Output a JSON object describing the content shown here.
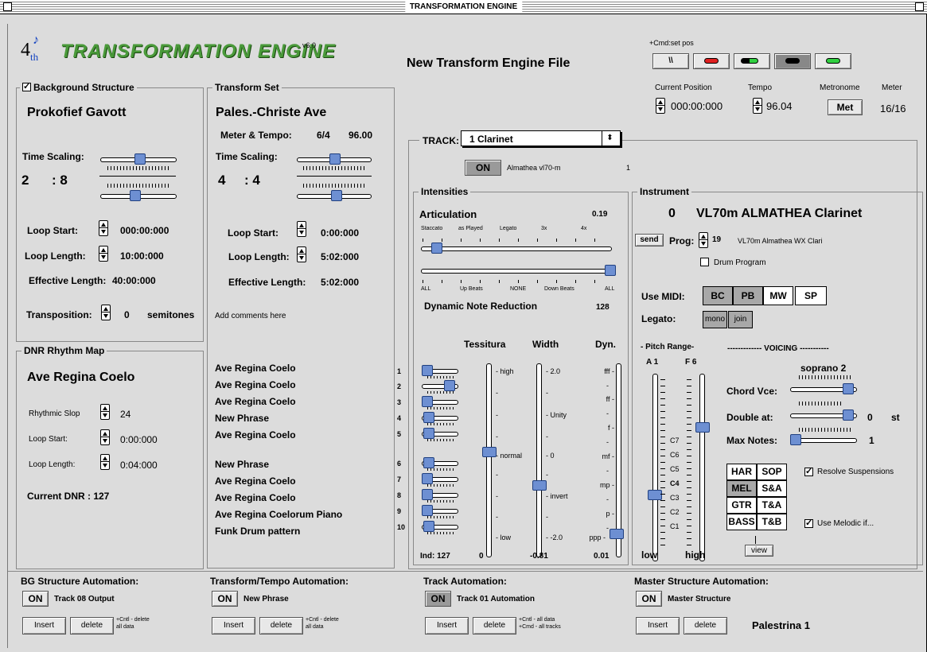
{
  "window": {
    "title": "TRANSFORMATION ENGINE"
  },
  "header": {
    "logo_num": "4",
    "logo_sup": "th",
    "app_title": "TRANSFORMATION ENGINE",
    "version": "v6.0",
    "file_name": "New Transform Engine File",
    "cmd_hint": "+Cmd:set pos"
  },
  "transport": {
    "backslash_label": "\\\\",
    "colors": {
      "red": "#e02020",
      "green": "#30d040",
      "black": "#000000"
    }
  },
  "status": {
    "position_label": "Current Position",
    "position": "000:00:000",
    "tempo_label": "Tempo",
    "tempo": "96.04",
    "metronome_label": "Metronome",
    "metronome_btn": "Met",
    "meter_label": "Meter",
    "meter": "16/16"
  },
  "bg": {
    "group_label": "Background Structure",
    "name": "Prokofief Gavott",
    "time_scaling_label": "Time Scaling:",
    "ts_num": "2",
    "ts_den": ": 8",
    "loop_start_label": "Loop Start:",
    "loop_start": "000:00:000",
    "loop_length_label": "Loop Length:",
    "loop_length": "10:00:000",
    "effective_label": "Effective Length:",
    "effective": "40:00:000",
    "transposition_label": "Transposition:",
    "transposition": "0",
    "semitones": "semitones"
  },
  "ts": {
    "group_label": "Transform Set",
    "name": "Pales.-Christe Ave",
    "meter_tempo_label": "Meter & Tempo:",
    "meter": "6/4",
    "tempo": "96.00",
    "time_scaling_label": "Time Scaling:",
    "ts_num": "4",
    "ts_den": ": 4",
    "loop_start_label": "Loop Start:",
    "loop_start": "0:00:000",
    "loop_length_label": "Loop Length:",
    "loop_length": "5:02:000",
    "effective_label": "Effective Length:",
    "effective": "5:02:000",
    "comments": "Add comments here"
  },
  "dnr": {
    "group_label": "DNR Rhythm Map",
    "name": "Ave Regina Coelo",
    "slop_label": "Rhythmic Slop",
    "slop": "24",
    "loop_start_label": "Loop Start:",
    "loop_start": "0:00:000",
    "loop_length_label": "Loop Length:",
    "loop_length": "0:04:000",
    "current_label": "Current DNR : 127"
  },
  "phrases": [
    "Ave Regina Coelo",
    "Ave Regina Coelo",
    "Ave Regina Coelo",
    "New Phrase",
    "Ave Regina Coelo",
    "New Phrase",
    "Ave Regina Coelo",
    "Ave Regina Coelo",
    "Ave Regina Coelorum Piano",
    "Funk Drum pattern"
  ],
  "track": {
    "label": "TRACK:",
    "selected": "1 Clarinet",
    "on": "ON",
    "device": "Almathea vl70-m",
    "channel": "1"
  },
  "intensities": {
    "group_label": "Intensities",
    "articulation_label": "Articulation",
    "articulation": "0.19",
    "art_marks": [
      "Staccato",
      "as Played",
      "Legato",
      "3x",
      "4x"
    ],
    "dnr_marks": [
      "ALL",
      "Up Beats",
      "NONE",
      "Down Beats",
      "ALL"
    ],
    "dnr_label": "Dynamic Note Reduction",
    "dnr": "128",
    "tessitura": "Tessitura",
    "width": "Width",
    "dyn": "Dyn.",
    "row_nums": [
      "1",
      "2",
      "3",
      "4",
      "5",
      "6",
      "7",
      "8",
      "9",
      "10"
    ],
    "tess_marks": [
      "high",
      "normal",
      "low"
    ],
    "width_marks": [
      "2.0",
      "Unity",
      "0",
      "invert",
      "-2.0"
    ],
    "dyn_marks": [
      "fff",
      "ff",
      "f",
      "mf",
      "mp",
      "p",
      "ppp"
    ],
    "ind": "Ind: 127",
    "tess_val": "0",
    "width_val": "-0.81",
    "dyn_val": "0.01"
  },
  "instrument": {
    "group_label": "Instrument",
    "num": "0",
    "name": "VL70m ALMATHEA Clarinet",
    "send": "send",
    "prog_label": "Prog:",
    "prog": "19",
    "prog_desc": "VL70m Almathea  WX Clari",
    "drum_program": "Drum Program",
    "use_midi_label": "Use MIDI:",
    "midi": [
      "BC",
      "PB",
      "MW",
      "SP"
    ],
    "legato_label": "Legato:",
    "legato": [
      "mono",
      "join"
    ],
    "pitch_range": "- Pitch Range-",
    "low_note": "A 1",
    "high_note": "F 6",
    "notes": [
      "C7",
      "C6",
      "C5",
      "C4",
      "C3",
      "C2",
      "C1"
    ],
    "low": "low",
    "high": "high",
    "view": "view",
    "voicing": "------------- VOICING -----------",
    "voice": "soprano 2",
    "chord_label": "Chord Vce:",
    "double_label": "Double at:",
    "double": "0",
    "st": "st",
    "max_label": "Max Notes:",
    "max": "1",
    "voicing_btns": [
      "HAR",
      "SOP",
      "MEL",
      "S&A",
      "GTR",
      "T&A",
      "BASS",
      "T&B"
    ],
    "resolve": "Resolve Suspensions",
    "melodic": "Use Melodic if..."
  },
  "automation": [
    {
      "title": "BG Structure Automation:",
      "on": "ON",
      "name": "Track 08 Output",
      "insert": "Insert",
      "delete": "delete",
      "hint1": "+Cntl - delete",
      "hint2": "all data"
    },
    {
      "title": "Transform/Tempo Automation:",
      "on": "ON",
      "name": "New Phrase",
      "insert": "Insert",
      "delete": "delete",
      "hint1": "+Cntl - delete",
      "hint2": "all data"
    },
    {
      "title": "Track Automation:",
      "on": "ON",
      "name": "Track 01 Automation",
      "insert": "Insert",
      "delete": "delete",
      "hint1": "+Cntl - all data",
      "hint2": "+Cmd - all tracks"
    },
    {
      "title": "Master Structure Automation:",
      "on": "ON",
      "name": "Master Structure",
      "insert": "Insert",
      "delete": "delete",
      "extra": "Palestrina 1"
    }
  ]
}
